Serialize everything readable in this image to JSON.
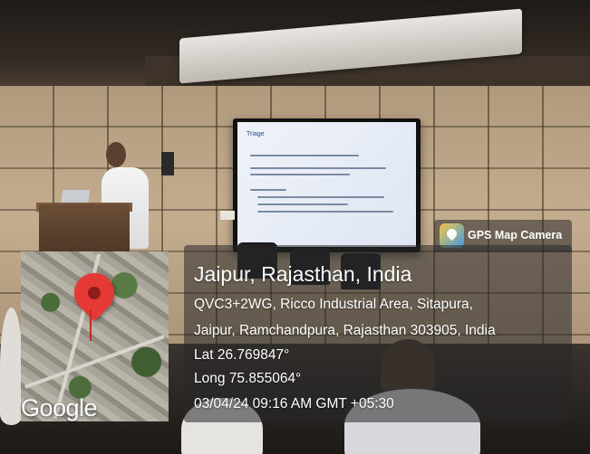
{
  "badge": {
    "label": "GPS Map Camera",
    "icon": "gps-map-camera-app-icon"
  },
  "location": {
    "city": "Jaipur, Rajasthan, India",
    "address_line1": "QVC3+2WG, Ricco Industrial Area, Sitapura,",
    "address_line2": "Jaipur, Ramchandpura, Rajasthan 303905, India",
    "latitude": "Lat 26.769847°",
    "longitude": "Long 75.855064°",
    "timestamp": "03/04/24 09:16 AM GMT +05:30"
  },
  "map": {
    "attribution": "Google",
    "pin_icon": "location-pin-icon"
  },
  "slide": {
    "title": "Triage"
  },
  "colors": {
    "pin": "#e53935",
    "overlay": "rgba(40,40,40,0.55)",
    "text": "#ffffff"
  }
}
